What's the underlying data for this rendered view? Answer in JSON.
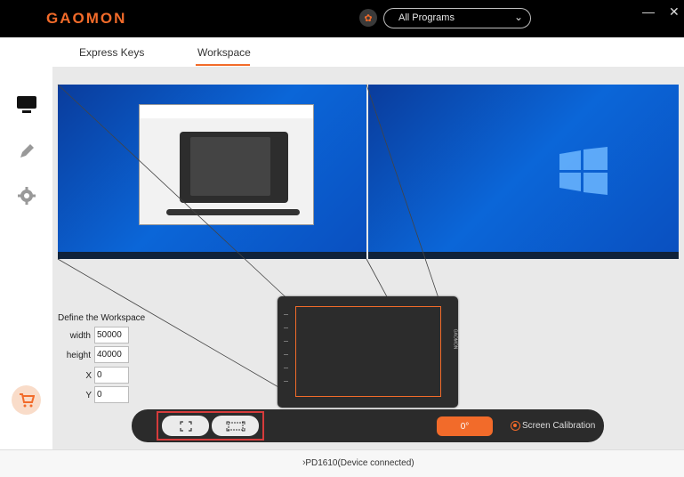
{
  "app": {
    "logo": "GAOMON",
    "program_select": "All Programs",
    "minimize": "—",
    "close": "✕"
  },
  "tabs": [
    {
      "label": "Express Keys",
      "active": false
    },
    {
      "label": "Workspace",
      "active": true
    }
  ],
  "sidebar": {
    "items": [
      {
        "icon": "monitor-icon",
        "active": true
      },
      {
        "icon": "pen-icon",
        "active": false
      },
      {
        "icon": "gear-icon",
        "active": false
      }
    ],
    "cart_icon": "cart-icon"
  },
  "screens": [
    {
      "name": "screen-1"
    },
    {
      "name": "screen-2"
    }
  ],
  "tablet": {
    "brand": "GAOMON"
  },
  "workspace": {
    "title": "Define the Workspace",
    "width_label": "width",
    "width_value": "50000",
    "height_label": "height",
    "height_value": "40000",
    "x_label": "X",
    "x_value": "0",
    "y_label": "Y",
    "y_value": "0"
  },
  "controls": {
    "rotation": "0°",
    "calibration_label": "Screen Calibration",
    "calibration_selected": true
  },
  "status": {
    "device": "PD1610(Device connected)"
  },
  "colors": {
    "accent": "#f26b2a",
    "titlebar": "#000000",
    "highlight": "#d63b3b"
  }
}
